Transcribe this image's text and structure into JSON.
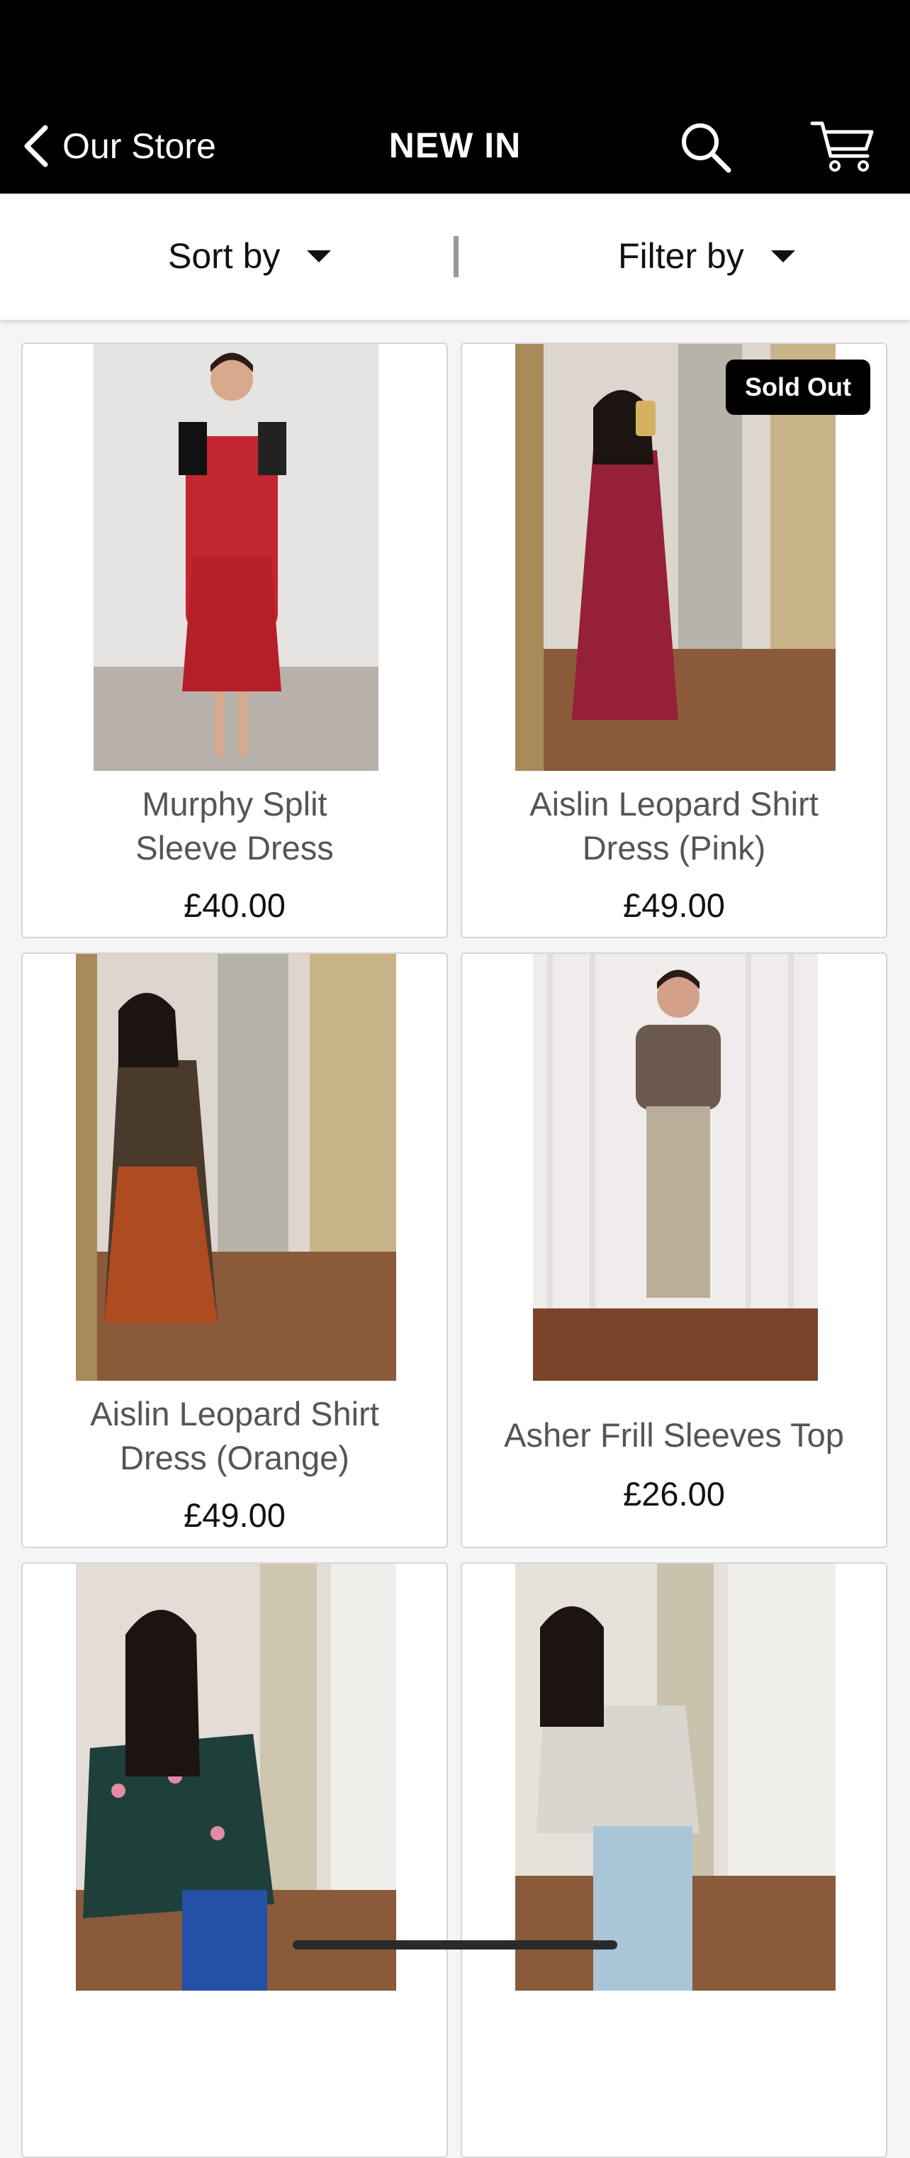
{
  "header": {
    "back_label": "Our Store",
    "title": "NEW IN",
    "search_icon": "search-icon",
    "cart_icon": "cart-icon"
  },
  "toolbar": {
    "sort_label": "Sort by",
    "filter_label": "Filter by"
  },
  "products": [
    {
      "name_line1": "Murphy Split",
      "name_line2": "Sleeve Dress",
      "price": "£40.00"
    },
    {
      "name_line1": "Aislin Leopard Shirt",
      "name_line2": "Dress (Pink)",
      "price": "£49.00",
      "badge": "Sold Out"
    },
    {
      "name_line1": "Aislin Leopard Shirt",
      "name_line2": "Dress (Orange)",
      "price": "£49.00"
    },
    {
      "name_line1": "Asher Frill Sleeves Top",
      "price": "£26.00"
    },
    {},
    {}
  ],
  "colors": {
    "header_bg": "#000000",
    "accent": "#000000",
    "card_border": "#d6d6d6"
  }
}
